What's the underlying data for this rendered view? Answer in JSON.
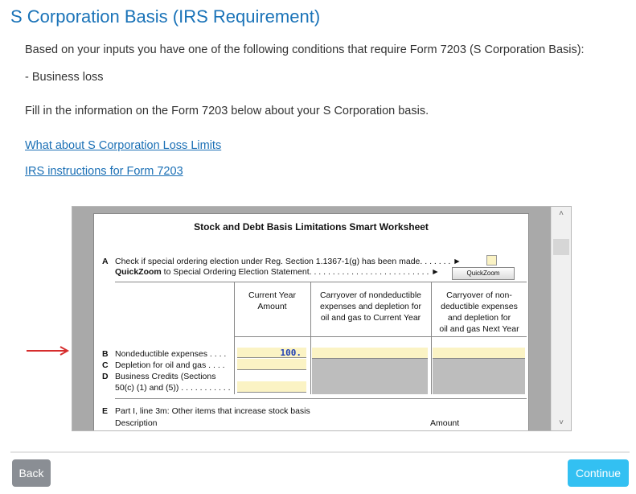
{
  "page": {
    "title": "S Corporation Basis (IRS Requirement)",
    "intro": "Based on your inputs you have one of the following conditions that require Form 7203 (S Corporation Basis):",
    "condition": " - Business loss",
    "instruction": "Fill in the information on the Form 7203 below about your S Corporation basis.",
    "link_loss_limits": "What about S Corporation Loss Limits",
    "link_irs_instructions": "IRS instructions for Form 7203"
  },
  "worksheet": {
    "title": "Stock and Debt Basis Limitations Smart Worksheet",
    "line_a_letter": "A",
    "line_a_text": "Check if special ordering election under Reg. Section 1.1367-1(g) has been made. . . . . . . ►",
    "quickzoom_bold": "QuickZoom",
    "quickzoom_text": " to Special Ordering Election Statement. . . . . . . . . . . . . . . . . . . . . . . . . . ►",
    "quickzoom_button": "QuickZoom",
    "col_current_1": "Current Year",
    "col_current_2": "Amount",
    "col_carry_1": "Carryover of nondeductible",
    "col_carry_2": "expenses and depletion for",
    "col_carry_3": "oil and gas to Current Year",
    "col_next_1": "Carryover of non-",
    "col_next_2": "deductible expenses",
    "col_next_3": "and depletion for",
    "col_next_4": "oil and gas Next Year",
    "line_b_letter": "B",
    "line_b_text": "Nondeductible expenses . . . .",
    "line_b_value": "100.",
    "line_c_letter": "C",
    "line_c_text": "Depletion for oil and gas . . . .",
    "line_d_letter": "D",
    "line_d_text_1": "Business Credits (Sections",
    "line_d_text_2": "50(c) (1) and (5)) . . . . . . . . . . .",
    "line_e_letter": "E",
    "line_e_text": "Part I, line 3m: Other items that increase stock basis",
    "line_e_desc": "Description",
    "line_e_amount": "Amount"
  },
  "buttons": {
    "back": "Back",
    "continue": "Continue"
  },
  "colors": {
    "title": "#1a73b8",
    "link": "#1a6fb5",
    "continue": "#33c0f2",
    "back": "#8a8e94",
    "arrow": "#d62d2d",
    "input_fill": "#fbf3c4"
  }
}
